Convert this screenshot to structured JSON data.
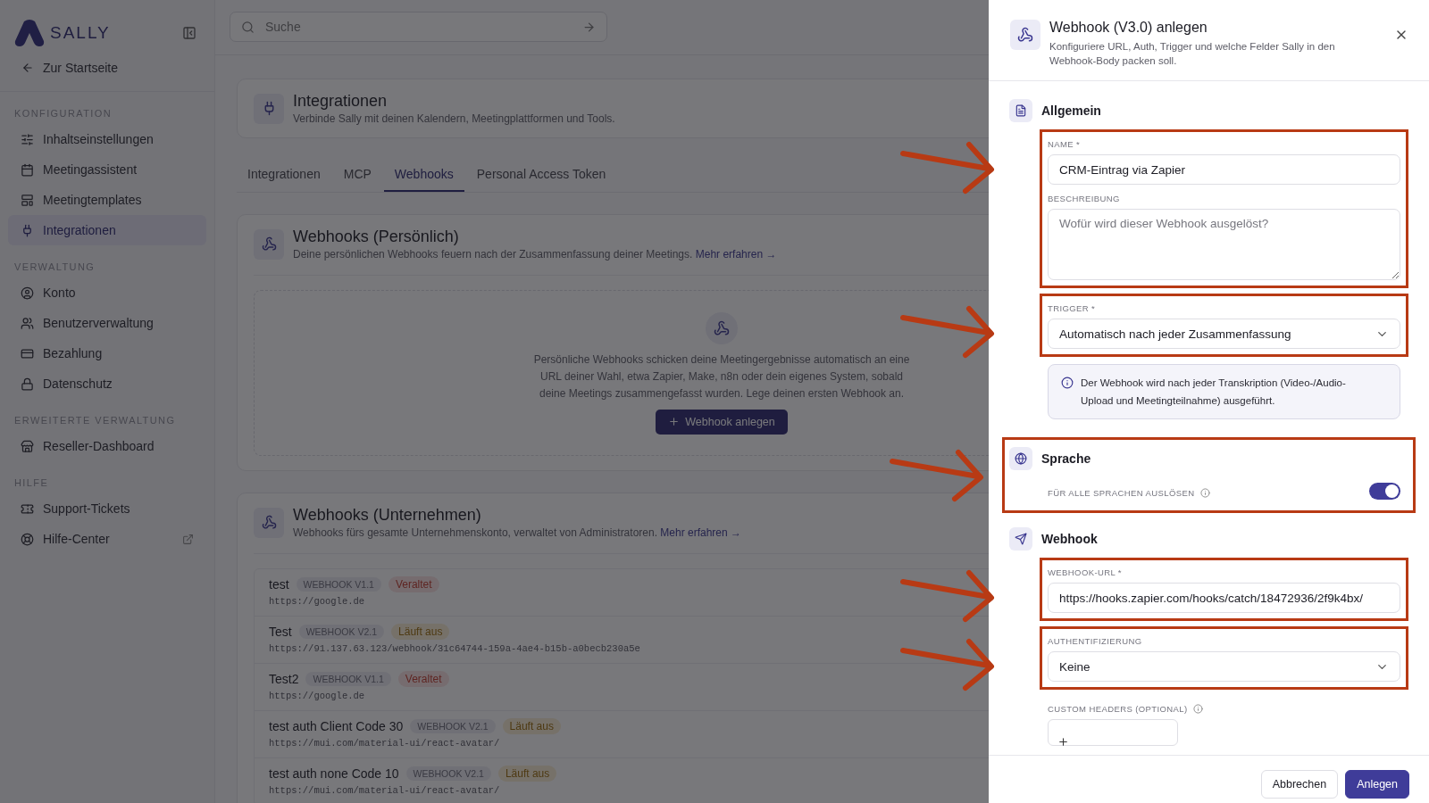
{
  "sidebar": {
    "logo": "SALLY",
    "back_link": "Zur Startseite",
    "groups": [
      {
        "heading": "KONFIGURATION",
        "items": [
          {
            "label": "Inhaltseinstellungen",
            "selected": false
          },
          {
            "label": "Meetingassistent",
            "selected": false
          },
          {
            "label": "Meetingtemplates",
            "selected": false
          },
          {
            "label": "Integrationen",
            "selected": true
          }
        ]
      },
      {
        "heading": "VERWALTUNG",
        "items": [
          {
            "label": "Konto",
            "selected": false
          },
          {
            "label": "Benutzerverwaltung",
            "selected": false
          },
          {
            "label": "Bezahlung",
            "selected": false
          },
          {
            "label": "Datenschutz",
            "selected": false
          }
        ]
      },
      {
        "heading": "ERWEITERTE VERWALTUNG",
        "items": [
          {
            "label": "Reseller-Dashboard",
            "selected": false
          }
        ]
      },
      {
        "heading": "HILFE",
        "items": [
          {
            "label": "Support-Tickets",
            "selected": false
          },
          {
            "label": "Hilfe-Center",
            "selected": false,
            "external": true
          }
        ]
      }
    ]
  },
  "search": {
    "placeholder": "Suche"
  },
  "page_header": {
    "title": "Integrationen",
    "subtitle": "Verbinde Sally mit deinen Kalendern, Meetingplattformen und Tools."
  },
  "tabs": [
    {
      "label": "Integrationen",
      "selected": false
    },
    {
      "label": "MCP",
      "selected": false
    },
    {
      "label": "Webhooks",
      "selected": true
    },
    {
      "label": "Personal Access Token",
      "selected": false
    }
  ],
  "sections": [
    {
      "title": "Webhooks (Persönlich)",
      "description": "Deine persönlichen Webhooks feuern nach der Zusammenfassung deiner Meetings.",
      "link": "Mehr erfahren →",
      "empty_state": {
        "text": "Persönliche Webhooks schicken deine Meetingergebnisse automatisch an eine URL deiner Wahl, etwa Zapier, Make, n8n oder dein eigenes System, sobald deine Meetings zusammengefasst wurden. Lege deinen ersten Webhook an.",
        "button": "Webhook anlegen"
      }
    },
    {
      "title": "Webhooks (Unternehmen)",
      "description": "Webhooks fürs gesamte Unternehmenskonto, verwaltet von Administratoren.",
      "link": "Mehr erfahren →",
      "webhooks": [
        {
          "name": "test",
          "version": "WEBHOOK V1.1",
          "status": {
            "label": "Veraltet",
            "kind": "deprecated"
          },
          "url": "https://google.de"
        },
        {
          "name": "Test",
          "version": "WEBHOOK V2.1",
          "status": {
            "label": "Läuft aus",
            "kind": "expiring"
          },
          "url": "https://91.137.63.123/webhook/31c64744-159a-4ae4-b15b-a0becb230a5e"
        },
        {
          "name": "Test2",
          "version": "WEBHOOK V1.1",
          "status": {
            "label": "Veraltet",
            "kind": "deprecated"
          },
          "url": "https://google.de"
        },
        {
          "name": "test auth Client Code 30",
          "version": "WEBHOOK V2.1",
          "status": {
            "label": "Läuft aus",
            "kind": "expiring"
          },
          "url": "https://mui.com/material-ui/react-avatar/"
        },
        {
          "name": "test auth none Code 10",
          "version": "WEBHOOK V2.1",
          "status": {
            "label": "Läuft aus",
            "kind": "expiring"
          },
          "url": "https://mui.com/material-ui/react-avatar/"
        }
      ]
    }
  ],
  "drawer": {
    "title": "Webhook (V3.0) anlegen",
    "subtitle": "Konfiguriere URL, Auth, Trigger und welche Felder Sally in den Webhook-Body packen soll.",
    "sections": [
      {
        "title": "Allgemein",
        "groups": [
          {
            "highlighted": true,
            "fields": [
              {
                "kind": "input",
                "label": "NAME *",
                "value": "CRM-Eintrag via Zapier"
              },
              {
                "kind": "textarea",
                "label": "BESCHREIBUNG",
                "placeholder": "Wofür wird dieser Webhook ausgelöst?"
              }
            ]
          },
          {
            "highlighted": true,
            "fields": [
              {
                "kind": "select",
                "label": "TRIGGER *",
                "value": "Automatisch nach jeder Zusammenfassung"
              }
            ]
          },
          {
            "fields": [
              {
                "kind": "info",
                "text": "Der Webhook wird nach jeder Transkription (Video-/Audio-Upload und Meetingteilnahme) ausgeführt."
              }
            ]
          }
        ]
      },
      {
        "title": "Sprache",
        "highlighted": true,
        "groups": [
          {
            "fields": [
              {
                "kind": "toggle",
                "label": "FÜR ALLE SPRACHEN AUSLÖSEN",
                "info": true,
                "on": true
              }
            ]
          }
        ]
      },
      {
        "title": "Webhook",
        "groups": [
          {
            "highlighted": true,
            "fields": [
              {
                "kind": "input",
                "label": "WEBHOOK-URL *",
                "value": "https://hooks.zapier.com/hooks/catch/18472936/2f9k4bx/"
              }
            ]
          },
          {
            "highlighted": true,
            "fields": [
              {
                "kind": "select",
                "label": "AUTHENTIFIZIERUNG",
                "value": "Keine"
              }
            ]
          },
          {
            "fields": [
              {
                "kind": "headers",
                "label": "CUSTOM HEADERS (OPTIONAL)",
                "info": true
              }
            ]
          }
        ]
      }
    ],
    "buttons": [
      {
        "label": "Abbrechen",
        "kind": "secondary"
      },
      {
        "label": "Anlegen",
        "kind": "primary"
      }
    ]
  }
}
